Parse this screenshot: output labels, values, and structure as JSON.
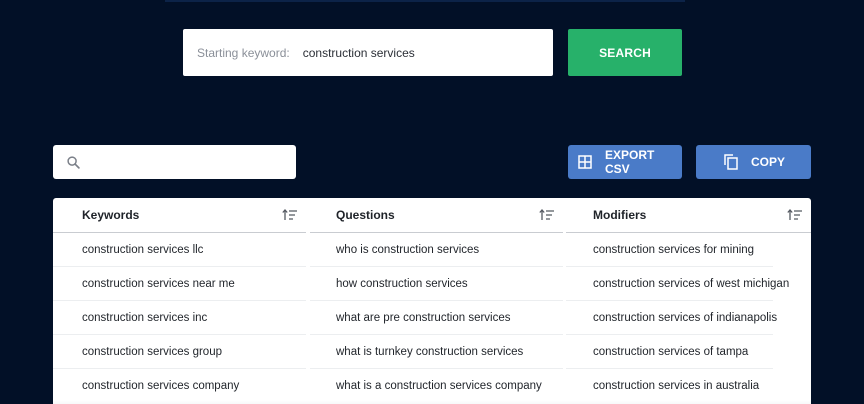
{
  "starting_keyword": {
    "label": "Starting keyword:",
    "value": "construction services"
  },
  "search_button": {
    "label": "SEARCH"
  },
  "filter": {
    "placeholder": "",
    "value": ""
  },
  "actions": {
    "export_csv_label": "EXPORT CSV",
    "copy_label": "COPY"
  },
  "icons": {
    "search": "search-icon",
    "export": "grid-icon",
    "copy": "copy-icon",
    "sort": "sort-icon"
  },
  "colors": {
    "background": "#021027",
    "search_button": "#27b16a",
    "action_button": "#4a7bc8"
  },
  "table": {
    "columns": [
      {
        "header": "Keywords",
        "rows": [
          "construction services llc",
          "construction services near me",
          "construction services inc",
          "construction services group",
          "construction services company"
        ]
      },
      {
        "header": "Questions",
        "rows": [
          "who is construction services",
          "how construction services",
          "what are pre construction services",
          "what is turnkey construction services",
          "what is a construction services company"
        ]
      },
      {
        "header": "Modifiers",
        "rows": [
          "construction services for mining",
          "construction services of west michigan",
          "construction services of indianapolis",
          "construction services of tampa",
          "construction services in australia"
        ]
      }
    ]
  }
}
